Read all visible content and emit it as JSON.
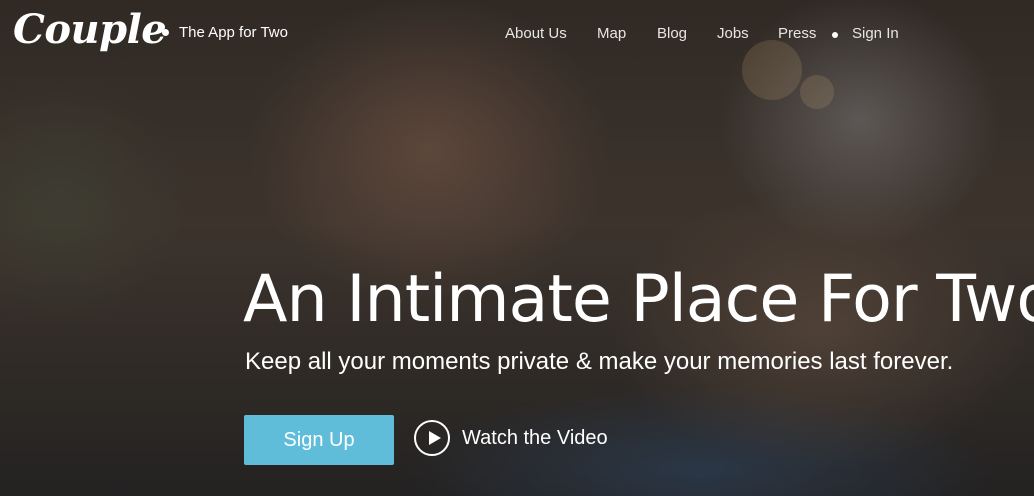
{
  "brand": {
    "logo": "Couple",
    "tagline": "The App for Two"
  },
  "nav": {
    "items": [
      {
        "label": "About Us"
      },
      {
        "label": "Map"
      },
      {
        "label": "Blog"
      },
      {
        "label": "Jobs"
      },
      {
        "label": "Press"
      },
      {
        "label": "Sign In"
      }
    ]
  },
  "hero": {
    "headline": "An Intimate Place For Two.",
    "subheadline": "Keep all your moments private & make your memories last forever.",
    "signup_label": "Sign Up",
    "video_label": "Watch the Video"
  },
  "colors": {
    "accent": "#5fbdd9",
    "text": "#ffffff"
  },
  "icons": [
    "play-icon",
    "bullet-dot-icon"
  ]
}
